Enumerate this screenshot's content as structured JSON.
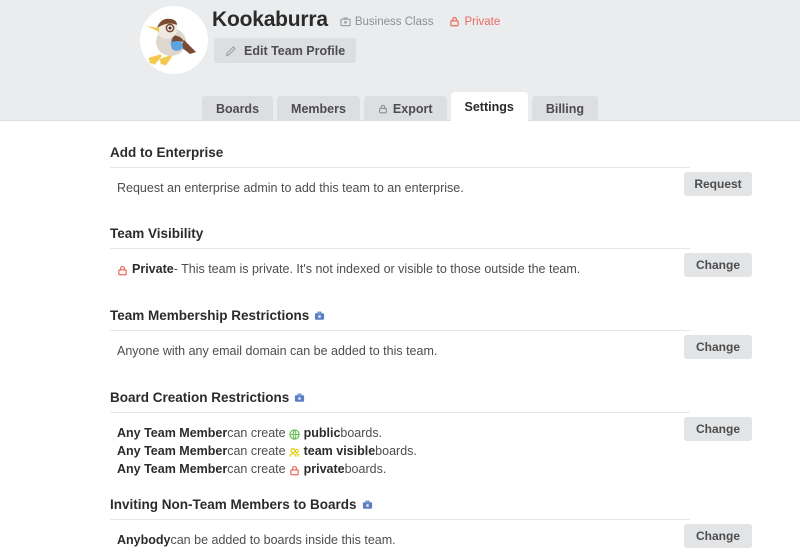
{
  "header": {
    "team_name": "Kookaburra",
    "avatar_alt": "kookaburra-bird-avatar",
    "business_class_label": "Business Class",
    "business_class_icon": "briefcase-icon",
    "privacy_label": "Private",
    "privacy_icon": "lock-icon",
    "edit_button_label": "Edit Team Profile",
    "edit_button_icon": "pencil-icon"
  },
  "tabs": [
    {
      "label": "Boards",
      "icon": null,
      "active": false
    },
    {
      "label": "Members",
      "icon": null,
      "active": false
    },
    {
      "label": "Export",
      "icon": "lock-icon",
      "active": false
    },
    {
      "label": "Settings",
      "icon": null,
      "active": true
    },
    {
      "label": "Billing",
      "icon": null,
      "active": false
    }
  ],
  "sections": {
    "add_to_enterprise": {
      "title": "Add to Enterprise",
      "title_icon": null,
      "text": "Request an enterprise admin to add this team to an enterprise.",
      "button": "Request"
    },
    "team_visibility": {
      "title": "Team Visibility",
      "title_icon": null,
      "icon": "lock-icon",
      "bold": "Private",
      "text": " - This team is private. It's not indexed or visible to those outside the team.",
      "button": "Change"
    },
    "team_membership_restrictions": {
      "title": "Team Membership Restrictions",
      "title_icon": "business-class-briefcase-icon",
      "text": "Anyone with any email domain can be added to this team.",
      "button": "Change"
    },
    "board_creation_restrictions": {
      "title": "Board Creation Restrictions",
      "title_icon": "business-class-briefcase-icon",
      "button": "Change",
      "rows": [
        {
          "who": "Any Team Member",
          "mid": " can create ",
          "icon": "globe-icon",
          "visibility": "public",
          "tail": " boards."
        },
        {
          "who": "Any Team Member",
          "mid": " can create ",
          "icon": "people-icon",
          "visibility": "team visible",
          "tail": " boards."
        },
        {
          "who": "Any Team Member",
          "mid": " can create ",
          "icon": "lock-icon",
          "visibility": "private",
          "tail": " boards."
        }
      ]
    },
    "inviting_non_team_members": {
      "title": "Inviting Non-Team Members to Boards",
      "title_icon": "business-class-briefcase-icon",
      "bold": "Anybody",
      "text": " can be added to boards inside this team.",
      "button": "Change"
    }
  },
  "colors": {
    "header_bg": "#ebecee",
    "tab_bg": "#dcdee1",
    "active_tab_bg": "#ffffff",
    "button_bg": "#e2e4e6",
    "private_red": "#eb6a5e",
    "public_green": "#61bd4f",
    "team_visible_yellow": "#f2d600",
    "business_blue": "#5a7fc4",
    "text_dark": "#2b2b2b",
    "text_body": "#4d4d4d",
    "muted": "#8c8f94"
  }
}
